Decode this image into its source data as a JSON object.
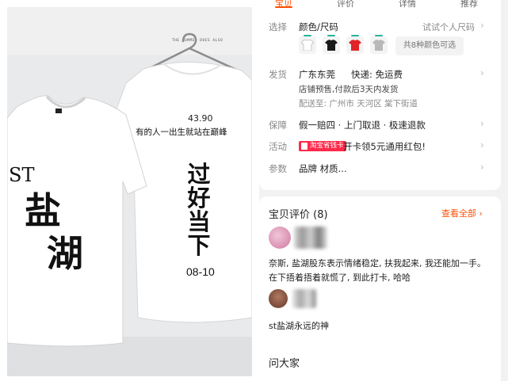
{
  "product_photo": {
    "brand_strip": "THE SUMMER DOES ALSO",
    "front": {
      "st_text": "ST",
      "chars": [
        "盐",
        "湖"
      ]
    },
    "back": {
      "price": "43.90",
      "motto": "有的人一出生就站在巅峰",
      "vertical_chars": [
        "过",
        "好",
        "当",
        "下"
      ],
      "date": "08-10"
    }
  },
  "detail": {
    "tabs": [
      {
        "label": "宝贝",
        "active": true
      },
      {
        "label": "评价",
        "active": false
      },
      {
        "label": "详情",
        "active": false
      },
      {
        "label": "推荐",
        "active": false
      }
    ],
    "select": {
      "label": "选择",
      "value": "颜色/尺码",
      "try_size": "试试个人尺码",
      "swatch_colors": [
        "#ffffff",
        "#1a1a1a",
        "#e0242a",
        "#b8b8b8"
      ],
      "count_text": "共8种颜色可选"
    },
    "shipping": {
      "label": "发货",
      "origin": "广东东莞",
      "fee": "快递: 免运费",
      "presale": "店铺预售,付款后3天内发货",
      "destination": "配送至: 广州市 天河区 棠下街道"
    },
    "guarantee": {
      "label": "保障",
      "value": "假一赔四 · 上门取退 · 极速退款"
    },
    "activity": {
      "label": "活动",
      "tag": "淘宝省钱卡",
      "text": "开卡领5元通用红包!"
    },
    "params": {
      "label": "参数",
      "value": "品牌 材质..."
    },
    "chevron": "›"
  },
  "reviews": {
    "title": "宝贝评价 (8)",
    "see_all": "查看全部 ›",
    "items": [
      {
        "text": "奈斯, 盐湖股东表示情绪稳定, 扶我起来, 我还能加一手。在下捂着捂着就慌了, 到此打卡, 哈哈"
      },
      {
        "text": "st盐湖永远的神"
      }
    ]
  },
  "ask": {
    "title": "问大家"
  }
}
